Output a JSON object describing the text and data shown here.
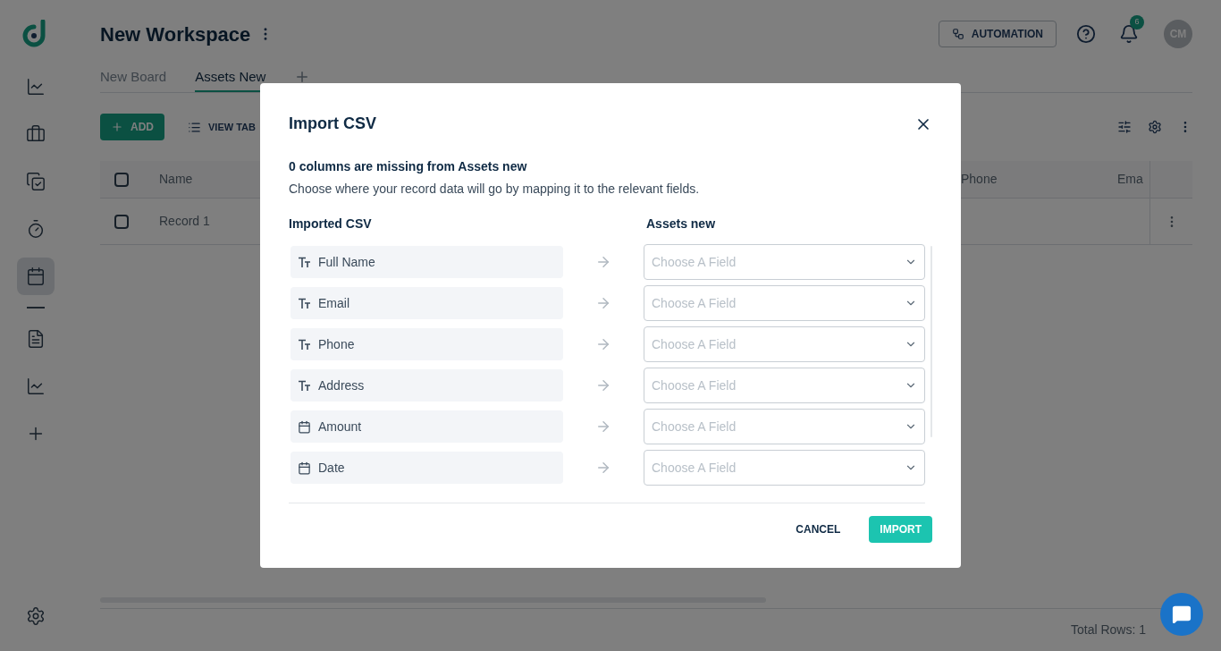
{
  "sidebar": {
    "groups": [
      {
        "items": [
          {
            "kind": "chart",
            "selected": false
          },
          {
            "kind": "briefcase",
            "selected": false
          },
          {
            "kind": "tasks",
            "selected": false
          },
          {
            "kind": "timer",
            "selected": false
          },
          {
            "kind": "calendar",
            "selected": true
          }
        ]
      },
      {
        "items": [
          {
            "kind": "document",
            "selected": false
          },
          {
            "kind": "chart",
            "selected": false
          },
          {
            "kind": "add",
            "selected": false
          }
        ]
      }
    ]
  },
  "header": {
    "title": "New Workspace",
    "automation_button": "AUTOMATION",
    "notification_count": "6",
    "avatar": "CM"
  },
  "tabs": [
    {
      "label": "New Board",
      "selected": false
    },
    {
      "label": "Assets New",
      "selected": true
    }
  ],
  "toolbar": {
    "add_button": "ADD",
    "view_button": "VIEW TAB"
  },
  "table": {
    "select_all_checked": false,
    "columns": [
      "Name",
      "Phone",
      "Ema"
    ],
    "rows": [
      {
        "name": "Record 1",
        "checked": false
      }
    ],
    "footer": "Total Rows: 1"
  },
  "dialog": {
    "title": "Import CSV",
    "summary": "0 columns are missing from Assets new",
    "description": "Choose where your record data will go by mapping it to the relevant fields.",
    "left_heading": "Imported CSV",
    "right_heading": "Assets new",
    "mappings": [
      {
        "kind": "text",
        "field": "Full Name",
        "placeholder": "Choose A Field"
      },
      {
        "kind": "text",
        "field": "Email",
        "placeholder": "Choose A Field"
      },
      {
        "kind": "text",
        "field": "Phone",
        "placeholder": "Choose A Field"
      },
      {
        "kind": "text",
        "field": "Address",
        "placeholder": "Choose A Field"
      },
      {
        "kind": "date",
        "field": "Amount",
        "placeholder": "Choose A Field"
      },
      {
        "kind": "date",
        "field": "Date",
        "placeholder": "Choose A Field"
      }
    ],
    "cancel": "CANCEL",
    "import": "IMPORT"
  }
}
